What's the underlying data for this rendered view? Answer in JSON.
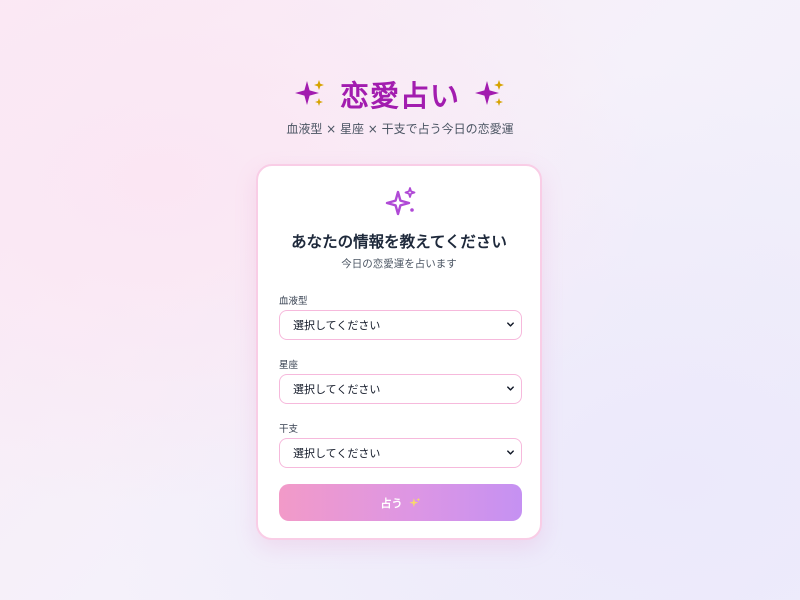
{
  "header": {
    "title": "恋愛占い",
    "subtitle": "血液型 × 星座 × 干支で占う今日の恋愛運",
    "icons": [
      "sparkles-icon",
      "sparkles-icon"
    ]
  },
  "card": {
    "icon": "sparkles-icon",
    "title": "あなたの情報を教えてください",
    "subtitle": "今日の恋愛運を占います",
    "fields": [
      {
        "label": "血液型",
        "value": "選択してください"
      },
      {
        "label": "星座",
        "value": "選択してください"
      },
      {
        "label": "干支",
        "value": "選択してください"
      }
    ],
    "submit_label": "占う",
    "submit_icon": "sparkles-icon"
  },
  "colors": {
    "accent": "#a21caf",
    "card_border": "#f9cde6",
    "select_border": "#f6b9dc",
    "button_start": "#f29ac8",
    "button_end": "#c591f2"
  }
}
